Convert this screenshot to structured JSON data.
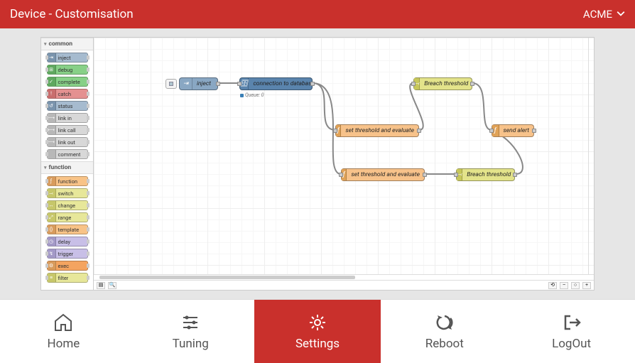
{
  "header": {
    "title": "Device - Customisation",
    "org": "ACME"
  },
  "palette": {
    "sections": [
      {
        "name": "common",
        "items": [
          {
            "label": "inject",
            "cls": "c-blue",
            "ico": "⇥",
            "ici": "ci-blue"
          },
          {
            "label": "debug",
            "cls": "c-green",
            "ico": "⊞",
            "ici": "ci-green"
          },
          {
            "label": "complete",
            "cls": "c-green",
            "ico": "✓",
            "ici": "ci-green"
          },
          {
            "label": "catch",
            "cls": "c-red",
            "ico": "!",
            "ici": "ci-red"
          },
          {
            "label": "status",
            "cls": "c-blue",
            "ico": "↺",
            "ici": "ci-blue"
          },
          {
            "label": "link in",
            "cls": "c-grey",
            "ico": "⟶",
            "ici": "ci-grey"
          },
          {
            "label": "link call",
            "cls": "c-grey",
            "ico": "⟷",
            "ici": "ci-grey"
          },
          {
            "label": "link out",
            "cls": "c-grey",
            "ico": "⟶",
            "ici": "ci-grey"
          },
          {
            "label": "comment",
            "cls": "c-grey",
            "ico": " ",
            "ici": "ci-grey"
          }
        ]
      },
      {
        "name": "function",
        "items": [
          {
            "label": "function",
            "cls": "c-org",
            "ico": "ƒ",
            "ici": "ci-org"
          },
          {
            "label": "switch",
            "cls": "c-yel",
            "ico": "⤙",
            "ici": "ci-yel"
          },
          {
            "label": "change",
            "cls": "c-yel",
            "ico": "↔",
            "ici": "ci-yel"
          },
          {
            "label": "range",
            "cls": "c-yel",
            "ico": "⤢",
            "ici": "ci-yel"
          },
          {
            "label": "template",
            "cls": "c-org",
            "ico": "{}",
            "ici": "ci-org"
          },
          {
            "label": "delay",
            "cls": "c-lav",
            "ico": "◷",
            "ici": "ci-lav"
          },
          {
            "label": "trigger",
            "cls": "c-lav",
            "ico": "↯",
            "ici": "ci-lav"
          },
          {
            "label": "exec",
            "cls": "c-dorg",
            "ico": "⚙",
            "ici": "ci-org"
          },
          {
            "label": "filter",
            "cls": "c-yel",
            "ico": "≡",
            "ici": "ci-yel"
          }
        ]
      }
    ]
  },
  "flow": {
    "nodes": {
      "inject": {
        "label": "inject",
        "status": "Queue: 0"
      },
      "db": {
        "label": "connection to database"
      },
      "th1": {
        "label": "set threshold and evaluate"
      },
      "th2": {
        "label": "set threshold and evaluate"
      },
      "br1": {
        "label": "Breach threshold"
      },
      "br2": {
        "label": "Breach threshold"
      },
      "alert": {
        "label": "send alert"
      }
    }
  },
  "nav": {
    "items": [
      {
        "key": "home",
        "label": "Home"
      },
      {
        "key": "tuning",
        "label": "Tuning"
      },
      {
        "key": "settings",
        "label": "Settings"
      },
      {
        "key": "reboot",
        "label": "Reboot"
      },
      {
        "key": "logout",
        "label": "LogOut"
      }
    ],
    "active": "settings"
  }
}
